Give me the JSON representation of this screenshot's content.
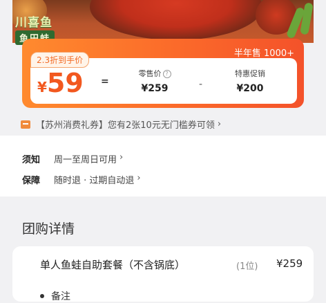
{
  "banner": {
    "brand_line1": "川喜鱼",
    "brand_line2": "鱼田蛙"
  },
  "price_card": {
    "sold_label": "半年售 1000+",
    "discount_tag": "2.3折到手价",
    "currency": "¥",
    "final_price": "59",
    "equals": "=",
    "retail_label": "零售价",
    "retail_value": "¥259",
    "minus": "-",
    "promo_label": "特惠促销",
    "promo_value": "¥200"
  },
  "coupon": {
    "text": "【苏州消费礼券】您有2张10元无门槛券可领",
    "chevron": "›"
  },
  "info": {
    "rows": [
      {
        "key": "须知",
        "value": "周一至周日可用"
      },
      {
        "key": "保障",
        "value": "随时退 · 过期自动退"
      }
    ],
    "chevron": "›"
  },
  "detail": {
    "title": "团购详情",
    "item_name": "单人鱼蛙自助套餐（不含锅底）",
    "item_qty": "(1位)",
    "item_price": "¥259",
    "sub_item": "备注"
  },
  "colors": {
    "accent": "#f2581f",
    "accent_light": "#ff8a2e"
  }
}
